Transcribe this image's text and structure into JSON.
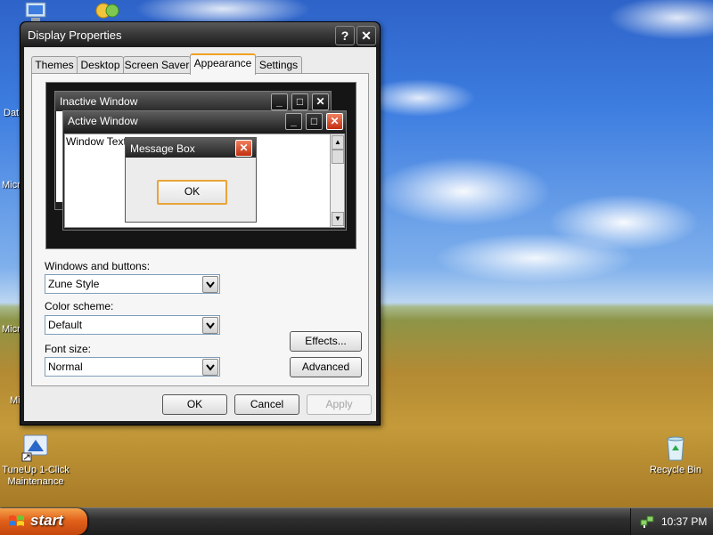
{
  "desktop": {
    "icons": [
      {
        "label": "TuneUp 1-Click Maintenance",
        "icon": "tuneup-icon"
      },
      {
        "label": "Recycle Bin",
        "icon": "recycle-bin-icon"
      }
    ],
    "partial_labels": [
      "Dat",
      "Micr C",
      "Micr E",
      "Mi"
    ]
  },
  "dialog": {
    "title": "Display Properties",
    "tabs": [
      "Themes",
      "Desktop",
      "Screen Saver",
      "Appearance",
      "Settings"
    ],
    "active_tab": "Appearance",
    "preview": {
      "inactive_title": "Inactive Window",
      "active_title": "Active Window",
      "window_text": "Window Text",
      "message_box_title": "Message Box",
      "ok_label": "OK"
    },
    "windows_and_buttons": {
      "label": "Windows and buttons:",
      "value": "Zune Style"
    },
    "color_scheme": {
      "label": "Color scheme:",
      "value": "Default"
    },
    "font_size": {
      "label": "Font size:",
      "value": "Normal"
    },
    "effects_label": "Effects...",
    "advanced_label": "Advanced",
    "ok_label": "OK",
    "cancel_label": "Cancel",
    "apply_label": "Apply"
  },
  "taskbar": {
    "start_label": "start",
    "clock": "10:37 PM"
  }
}
